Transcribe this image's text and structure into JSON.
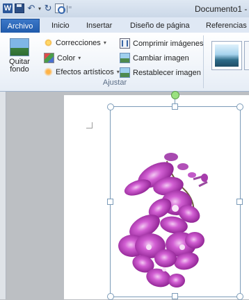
{
  "app": {
    "logo_letter": "W",
    "doc_title": "Documento1 -"
  },
  "tabs": [
    {
      "label": "Archivo",
      "active": true
    },
    {
      "label": "Inicio"
    },
    {
      "label": "Insertar"
    },
    {
      "label": "Diseño de página"
    },
    {
      "label": "Referencias"
    }
  ],
  "ribbon": {
    "remove_bg": {
      "line1": "Quitar",
      "line2": "fondo"
    },
    "corrections": "Correcciones",
    "color": "Color",
    "artistic": "Efectos artísticos",
    "compress": "Comprimir imágenes",
    "change": "Cambiar imagen",
    "reset": "Restablecer imagen",
    "group_label": "Ajustar"
  },
  "colors": {
    "file_tab": "#2a64b4",
    "selection": "#7b9bb8",
    "orchid": "#b12fb5"
  }
}
